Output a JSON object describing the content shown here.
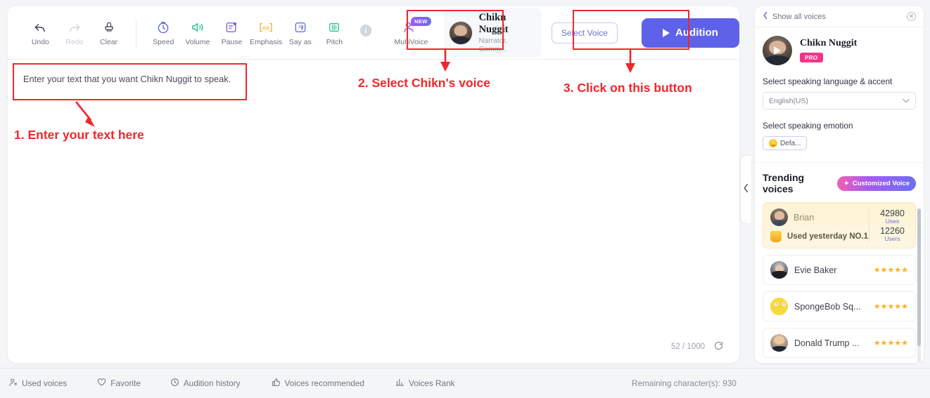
{
  "toolbar": {
    "history": [
      {
        "label": "Undo",
        "icon": "undo-icon",
        "disabled": false
      },
      {
        "label": "Redo",
        "icon": "redo-icon",
        "disabled": true
      },
      {
        "label": "Clear",
        "icon": "clear-icon",
        "disabled": false
      }
    ],
    "effects": [
      {
        "label": "Speed",
        "icon": "speed-icon",
        "color": "#5d62e8"
      },
      {
        "label": "Volume",
        "icon": "volume-icon",
        "color": "#23c08a"
      },
      {
        "label": "Pause",
        "icon": "pause-icon",
        "color": "#7b5ce8"
      },
      {
        "label": "Emphasis",
        "icon": "emphasis-icon",
        "color": "#f5a623"
      },
      {
        "label": "Say as",
        "icon": "say-as-icon",
        "color": "#5d62e8"
      },
      {
        "label": "Pitch",
        "icon": "pitch-icon",
        "color": "#23c08a"
      }
    ],
    "info_icon": "info-icon",
    "multivoice": {
      "label": "MultiVoice",
      "badge": "NEW",
      "icon": "multivoice-icon"
    },
    "voice_chip": {
      "name": "Chikn Nuggit",
      "subtitle": "Narrator, Comm...",
      "avatar": "voice-avatar"
    },
    "select_voice_label": "Select Voice",
    "audition_label": "Audition",
    "audition_color": "#5d62e8"
  },
  "editor": {
    "text": "Enter your text that you want Chikn Nuggit to speak.",
    "char_count": "52",
    "char_separator": "/",
    "char_limit": "1000",
    "refresh_icon": "refresh-icon"
  },
  "annotations": [
    {
      "id": "1",
      "text": "1. Enter your text here"
    },
    {
      "id": "2",
      "text": "2. Select Chikn's voice"
    },
    {
      "id": "3",
      "text": "3. Click on this button"
    }
  ],
  "collapse_handle": {
    "icon": "chevron-left-icon"
  },
  "right_panel": {
    "back_label": "Show all voices",
    "back_icon": "chevron-left-icon",
    "close_icon": "close-icon",
    "voice": {
      "name": "Chikn Nuggit",
      "badge": "PRO"
    },
    "language_label": "Select speaking language & accent",
    "language_value": "English(US)",
    "language_chevron": "chevron-down-icon",
    "emotion_label": "Select speaking emotion",
    "emotion_value": "Defa...",
    "emotion_icon": "smiley-icon",
    "trending_title": "Trending voices",
    "customized_button": "Customized Voice",
    "customized_icon": "sparkle-icon",
    "featured": {
      "name": "Brian",
      "used_label": "Used yesterday NO.1",
      "trophy_icon": "trophy-icon",
      "uses_value": "42980",
      "uses_label": "Uses",
      "users_value": "12260",
      "users_label": "Users"
    },
    "voices": [
      {
        "name": "Evie Baker",
        "stars": "★★★★★",
        "avatar": "evie-avatar"
      },
      {
        "name": "SpongeBob Sq...",
        "stars": "★★★★★",
        "avatar": "spongebob-avatar"
      },
      {
        "name": "Donald Trump ...",
        "stars": "★★★★★",
        "avatar": "trump-avatar"
      }
    ]
  },
  "bottom_bar": {
    "items": [
      {
        "label": "Used voices",
        "icon": "person-icon"
      },
      {
        "label": "Favorite",
        "icon": "heart-icon"
      },
      {
        "label": "Audition history",
        "icon": "clock-icon"
      },
      {
        "label": "Voices recommended",
        "icon": "thumbs-up-icon"
      },
      {
        "label": "Voices Rank",
        "icon": "bar-chart-icon"
      }
    ],
    "remaining": "Remaining character(s): 930"
  }
}
